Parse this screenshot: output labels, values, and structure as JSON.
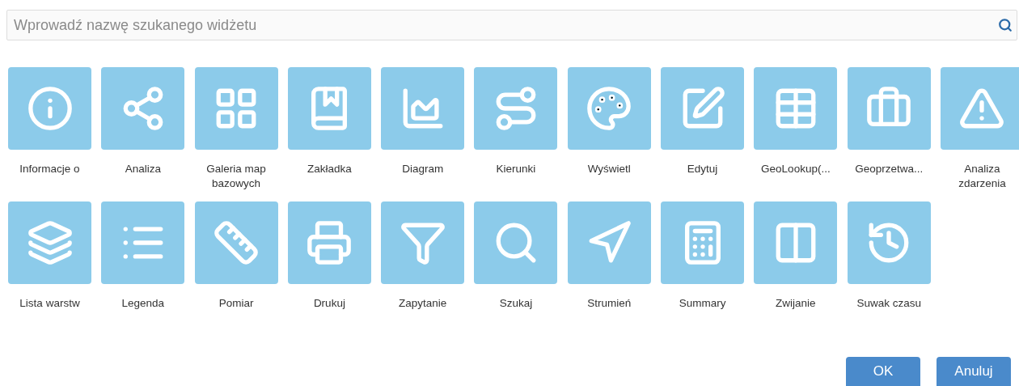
{
  "search": {
    "placeholder": "Wprowadź nazwę szukanego widżetu"
  },
  "widgets": [
    {
      "label": "Informacje o"
    },
    {
      "label": "Analiza"
    },
    {
      "label": "Galeria map bazowych"
    },
    {
      "label": "Zakładka"
    },
    {
      "label": "Diagram"
    },
    {
      "label": "Kierunki"
    },
    {
      "label": "Wyświetl"
    },
    {
      "label": "Edytuj"
    },
    {
      "label": "GeoLookup(..."
    },
    {
      "label": "Geoprzetwa..."
    },
    {
      "label": "Analiza zdarzenia"
    },
    {
      "label": "Lista warstw"
    },
    {
      "label": "Legenda"
    },
    {
      "label": "Pomiar"
    },
    {
      "label": "Drukuj"
    },
    {
      "label": "Zapytanie"
    },
    {
      "label": "Szukaj"
    },
    {
      "label": "Strumień"
    },
    {
      "label": "Summary"
    },
    {
      "label": "Zwijanie"
    },
    {
      "label": "Suwak czasu"
    }
  ],
  "buttons": [
    "OK",
    "Anuluj"
  ]
}
